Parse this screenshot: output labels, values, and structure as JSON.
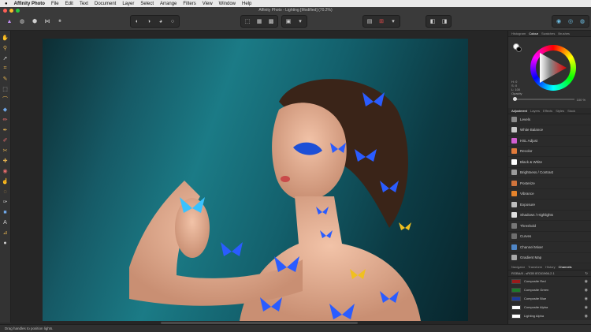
{
  "menubar": {
    "app_name": "Affinity Photo",
    "menus": [
      "File",
      "Edit",
      "Text",
      "Document",
      "Layer",
      "Select",
      "Arrange",
      "Filters",
      "View",
      "Window",
      "Help"
    ]
  },
  "window": {
    "title": "Affinity Photo - Lighting [Modified] (70.2%)"
  },
  "panels": {
    "top_tabs": [
      "Histogram",
      "Colour",
      "Swatches",
      "Brushes"
    ],
    "active_top_tab": "Colour",
    "color": {
      "h_label": "H: 0",
      "s_label": "S: 0",
      "l_label": "L: 100",
      "opacity_label": "Opacity",
      "opacity_value": "100 %"
    },
    "mid_tabs": [
      "Adjustment",
      "Layers",
      "Effects",
      "Styles",
      "Stock"
    ],
    "active_mid_tab": "Adjustment",
    "adjustments": [
      {
        "label": "Levels",
        "color": "#8a8a8a"
      },
      {
        "label": "White Balance",
        "color": "#c9c9c9"
      },
      {
        "label": "HSL Adjust",
        "color": "#d25ed0"
      },
      {
        "label": "Recolor",
        "color": "#e07a3a"
      },
      {
        "label": "Black & White",
        "color": "#ffffff"
      },
      {
        "label": "Brightness / Contrast",
        "color": "#9b9b9b"
      },
      {
        "label": "Posterize",
        "color": "#d0743c"
      },
      {
        "label": "Vibrance",
        "color": "#e5832b"
      },
      {
        "label": "Exposure",
        "color": "#bdbdbd"
      },
      {
        "label": "Shadows / Highlights",
        "color": "#e0e0e0"
      },
      {
        "label": "Threshold",
        "color": "#777777"
      },
      {
        "label": "Curves",
        "color": "#6e6e6e"
      },
      {
        "label": "Channel Mixer",
        "color": "#4f86c6"
      },
      {
        "label": "Gradient Map",
        "color": "#a8a8a8"
      }
    ],
    "bottom_tabs": [
      "Navigator",
      "Transform",
      "History",
      "Channels"
    ],
    "active_bottom_tab": "Channels",
    "channels_header": "RGBA/8 - sRGB IEC61966-2.1",
    "channels": [
      {
        "label": "Composite Red",
        "color": "#9a1b1b"
      },
      {
        "label": "Composite Green",
        "color": "#1b7a2a"
      },
      {
        "label": "Composite Blue",
        "color": "#1b3a9a"
      },
      {
        "label": "Composite Alpha",
        "color": "#ffffff"
      },
      {
        "label": "Lighting Alpha",
        "color": "#ffffff"
      }
    ]
  },
  "status": {
    "text": "Drag handles to position lights."
  }
}
